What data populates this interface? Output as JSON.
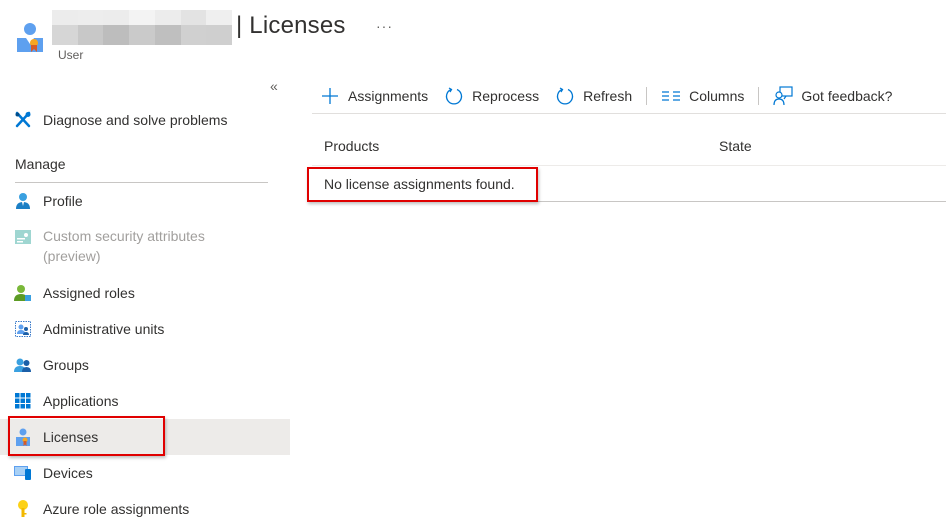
{
  "header": {
    "title": "| Licenses",
    "subtitle": "User",
    "more_label": "···",
    "user_name_redacted": true
  },
  "sidebar": {
    "collapse_label": "«",
    "top_items": [
      {
        "label": "Diagnose and solve problems",
        "icon": "wrench-icon"
      }
    ],
    "section_title": "Manage",
    "items": [
      {
        "label": "Profile",
        "icon": "profile-icon",
        "disabled": false
      },
      {
        "label": "Custom security attributes (preview)",
        "icon": "security-attributes-icon",
        "disabled": true
      },
      {
        "label": "Assigned roles",
        "icon": "assigned-roles-icon",
        "disabled": false
      },
      {
        "label": "Administrative units",
        "icon": "admin-units-icon",
        "disabled": false
      },
      {
        "label": "Groups",
        "icon": "groups-icon",
        "disabled": false
      },
      {
        "label": "Applications",
        "icon": "applications-icon",
        "disabled": false
      },
      {
        "label": "Licenses",
        "icon": "licenses-icon",
        "disabled": false,
        "selected": true
      },
      {
        "label": "Devices",
        "icon": "devices-icon",
        "disabled": false
      },
      {
        "label": "Azure role assignments",
        "icon": "key-icon",
        "disabled": false
      }
    ]
  },
  "toolbar": {
    "assignments_label": "Assignments",
    "reprocess_label": "Reprocess",
    "refresh_label": "Refresh",
    "columns_label": "Columns",
    "feedback_label": "Got feedback?"
  },
  "grid": {
    "columns": [
      "Products",
      "State"
    ],
    "empty_message": "No license assignments found."
  },
  "colors": {
    "accent": "#0078d4",
    "highlight": "#e00000",
    "selected_bg": "#edebe9"
  }
}
